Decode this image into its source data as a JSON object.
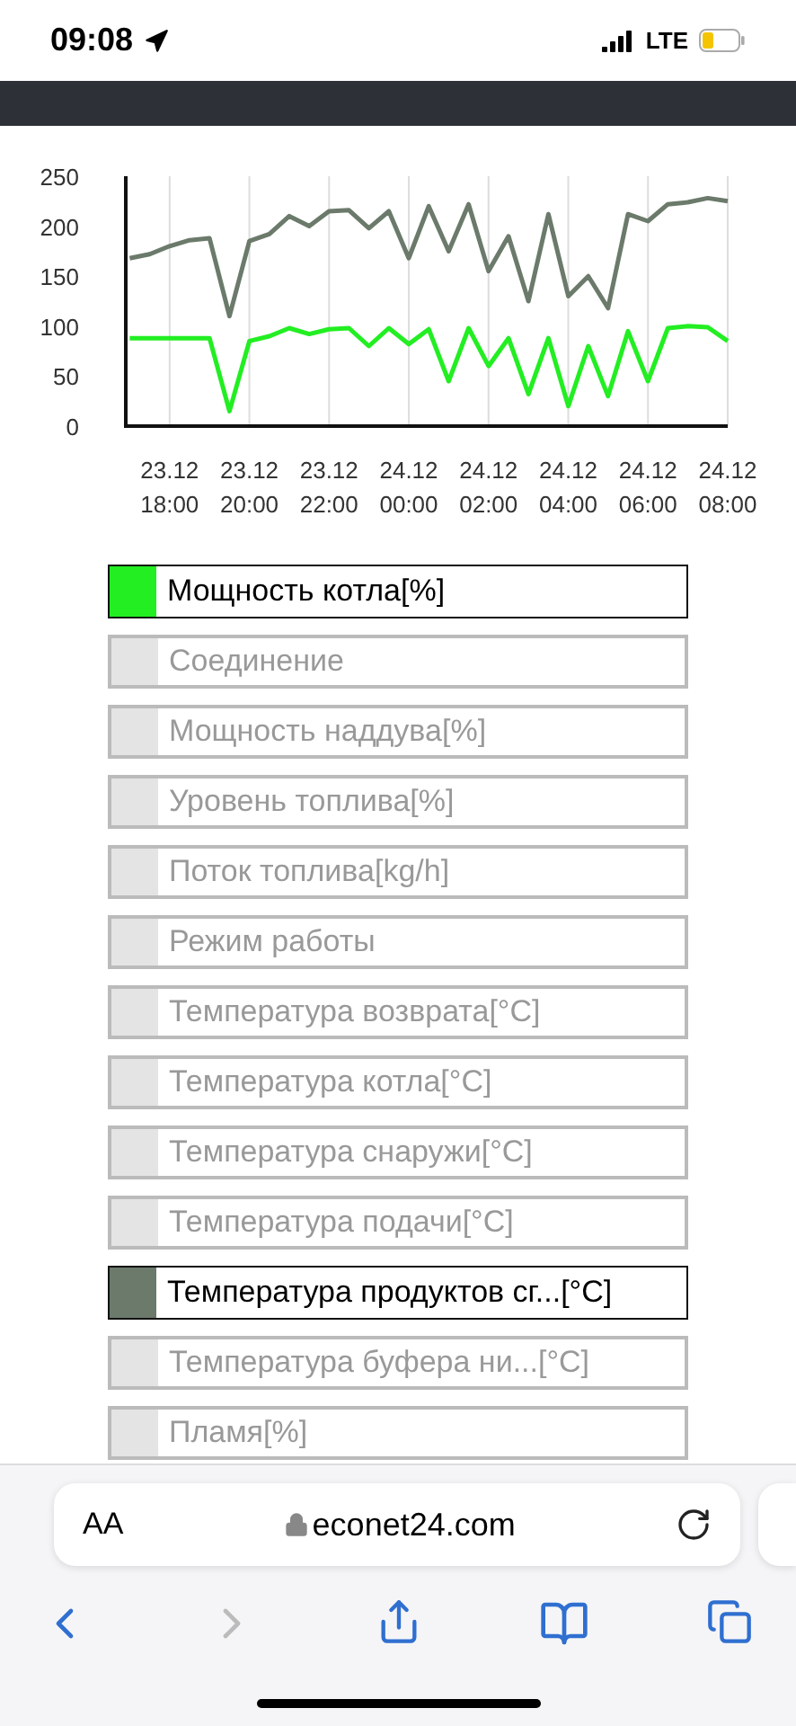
{
  "status_bar": {
    "time": "09:08",
    "network": "LTE"
  },
  "chart": {
    "chart_data": {
      "type": "line",
      "categories": [
        null,
        null,
        "23.12 18:00",
        null,
        null,
        null,
        "23.12 20:00",
        null,
        null,
        null,
        "23.12 22:00",
        null,
        null,
        null,
        "24.12 00:00",
        null,
        null,
        null,
        "24.12 02:00",
        null,
        null,
        null,
        "24.12 04:00",
        null,
        null,
        null,
        "24.12 06:00",
        null,
        null,
        null,
        "24.12 08:00"
      ],
      "series": [
        {
          "color": "#6b7a6b",
          "values": [
            168,
            172,
            180,
            186,
            188,
            110,
            185,
            192,
            210,
            200,
            215,
            216,
            198,
            215,
            168,
            220,
            175,
            222,
            155,
            190,
            125,
            212,
            130,
            150,
            118,
            212,
            205,
            222,
            224,
            228,
            225
          ]
        },
        {
          "color": "#22ee22",
          "values": [
            88,
            88,
            88,
            88,
            88,
            15,
            85,
            90,
            98,
            92,
            97,
            98,
            80,
            98,
            82,
            97,
            45,
            98,
            60,
            88,
            32,
            88,
            20,
            80,
            30,
            95,
            45,
            98,
            100,
            99,
            85
          ]
        }
      ],
      "grid": true,
      "ylim": [
        0,
        250
      ],
      "yticks": [
        0,
        50,
        100,
        150,
        200,
        250
      ]
    }
  },
  "legend": [
    {
      "label": "Мощность котла[%]",
      "selected": true,
      "color": "#22ee22"
    },
    {
      "label": "Соединение",
      "selected": false
    },
    {
      "label": "Мощность наддува[%]",
      "selected": false
    },
    {
      "label": "Уровень топлива[%]",
      "selected": false
    },
    {
      "label": "Поток топлива[kg/h]",
      "selected": false
    },
    {
      "label": "Режим работы",
      "selected": false
    },
    {
      "label": "Температура возврата[°C]",
      "selected": false
    },
    {
      "label": "Температура котла[°C]",
      "selected": false
    },
    {
      "label": "Температура снаружи[°C]",
      "selected": false
    },
    {
      "label": "Температура подачи[°C]",
      "selected": false
    },
    {
      "label": "Температура продуктов сг...[°C]",
      "selected": true,
      "color": "#6b7a6b"
    },
    {
      "label": "Температура буфера ни...[°C]",
      "selected": false
    },
    {
      "label": "Пламя[%]",
      "selected": false
    }
  ],
  "browser": {
    "text_size": "AA",
    "url": "econet24.com"
  }
}
